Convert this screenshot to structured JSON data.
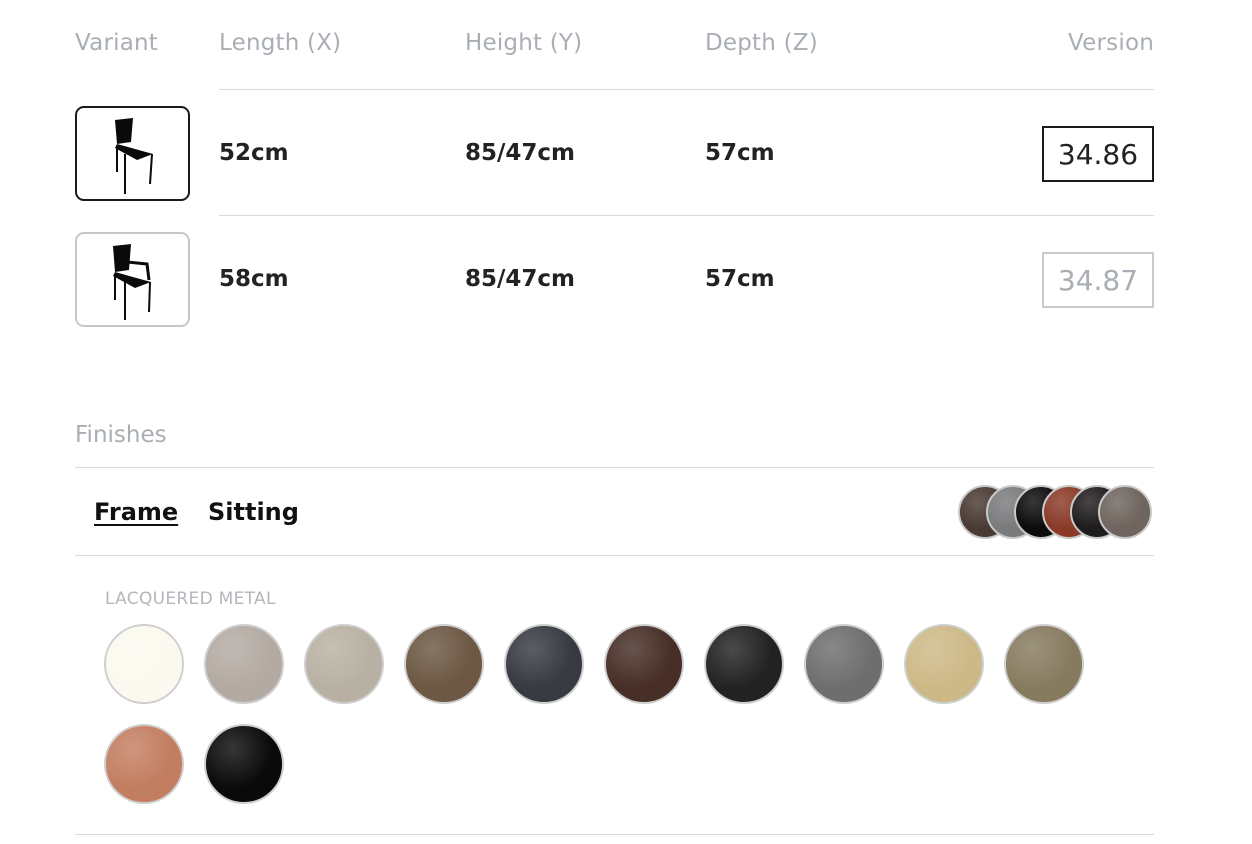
{
  "headers": {
    "variant": "Variant",
    "length": "Length (X)",
    "height": "Height (Y)",
    "depth": "Depth (Z)",
    "version": "Version"
  },
  "rows": [
    {
      "icon": "side-chair-icon",
      "length": "52cm",
      "height": "85/47cm",
      "depth": "57cm",
      "version": "34.86",
      "selected": true
    },
    {
      "icon": "armchair-icon",
      "length": "58cm",
      "height": "85/47cm",
      "depth": "57cm",
      "version": "34.87",
      "selected": false
    }
  ],
  "finishes": {
    "title": "Finishes",
    "tabs": [
      "Frame",
      "Sitting"
    ],
    "active_tab": "Frame",
    "preview_colors": [
      "#4a3a33",
      "#7a7b7d",
      "#0c0c0c",
      "#8b3a28",
      "#1f1c1d",
      "#6f655e"
    ],
    "group_label": "LACQUERED METAL",
    "swatches": [
      {
        "name": "white",
        "color": "#fbf9ef"
      },
      {
        "name": "dove-grey",
        "color": "#b3aaa2"
      },
      {
        "name": "sand",
        "color": "#b8b1a3"
      },
      {
        "name": "bronze",
        "color": "#6c5843"
      },
      {
        "name": "dark-blue",
        "color": "#383a42"
      },
      {
        "name": "dark-brown",
        "color": "#472e27"
      },
      {
        "name": "black",
        "color": "#222222"
      },
      {
        "name": "grey-metal",
        "color": "#6e6e6e"
      },
      {
        "name": "gold",
        "color": "#cdb987"
      },
      {
        "name": "olive-bronze",
        "color": "#877b5f"
      },
      {
        "name": "copper",
        "color": "#c37e61"
      },
      {
        "name": "gloss-black",
        "color": "#0a0a0a"
      }
    ]
  }
}
